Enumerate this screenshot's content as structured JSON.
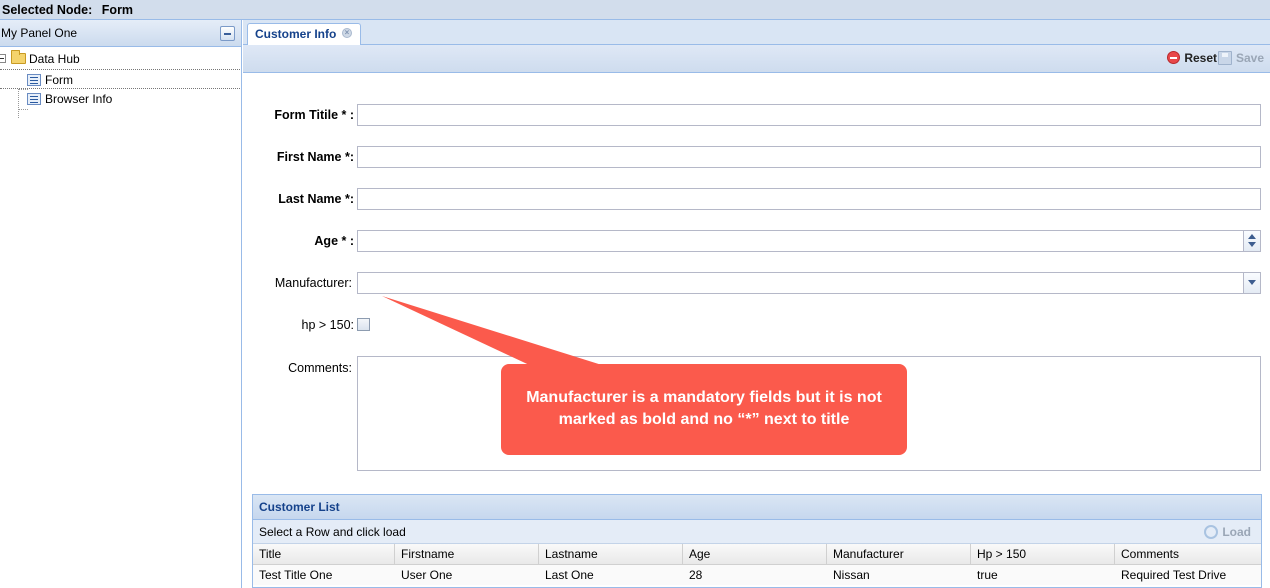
{
  "top_bar": {
    "label": "Selected Node:",
    "value": "Form"
  },
  "left_panel": {
    "title": "My Panel One",
    "tree": {
      "root": "Data Hub",
      "children": [
        "Form",
        "Browser Info"
      ]
    }
  },
  "tabs": [
    {
      "label": "Customer Info"
    }
  ],
  "toolbar": {
    "reset_label": "Reset",
    "save_label": "Save"
  },
  "form": {
    "fields": [
      {
        "label": "Form Titile * :",
        "value": ""
      },
      {
        "label": "First Name *:",
        "value": ""
      },
      {
        "label": "Last Name *:",
        "value": ""
      },
      {
        "label": "Age * :",
        "value": ""
      },
      {
        "label": "Manufacturer:",
        "value": ""
      },
      {
        "label": "hp > 150:",
        "checked": false
      },
      {
        "label": "Comments:",
        "value": ""
      }
    ]
  },
  "customer_list": {
    "title": "Customer List",
    "toolbar_text": "Select a Row and click load",
    "load_label": "Load",
    "columns": [
      "Title",
      "Firstname",
      "Lastname",
      "Age",
      "Manufacturer",
      "Hp > 150",
      "Comments"
    ],
    "rows": [
      [
        "Test Title One",
        "User One",
        "Last One",
        "28",
        "Nissan",
        "true",
        "Required Test Drive"
      ]
    ]
  },
  "annotation": {
    "text": "Manufacturer is a mandatory fields but it is not marked as bold and no “*” next to title",
    "color": "#fb5a4c"
  }
}
